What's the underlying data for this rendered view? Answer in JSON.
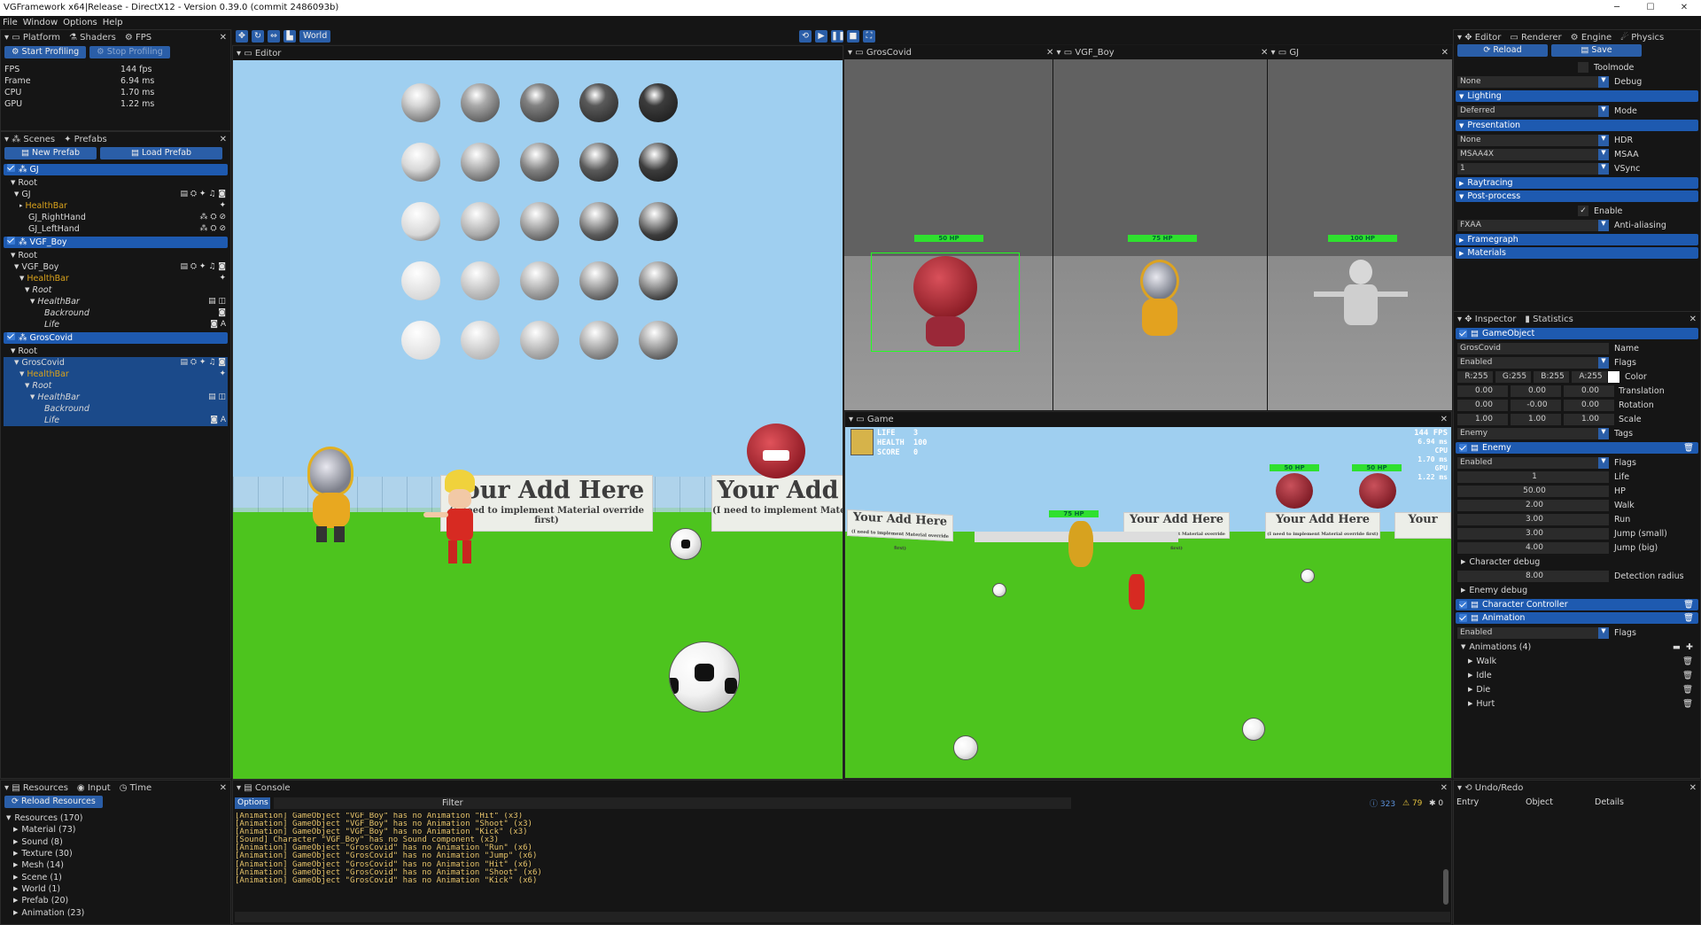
{
  "window": {
    "title": "VGFramework x64|Release - DirectX12 - Version 0.39.0 (commit 2486093b)"
  },
  "menu": [
    "File",
    "Window",
    "Options",
    "Help"
  ],
  "top_tabs": {
    "platform": "Platform",
    "shaders": "Shaders",
    "fps": "FPS"
  },
  "profiling": {
    "start": "Start Profiling",
    "stop": "Stop Profiling"
  },
  "stats": [
    {
      "k": "FPS",
      "v": "144 fps"
    },
    {
      "k": "Frame",
      "v": "6.94 ms"
    },
    {
      "k": "CPU",
      "v": "1.70 ms"
    },
    {
      "k": "GPU",
      "v": "1.22 ms"
    }
  ],
  "toolbar": {
    "world": "World"
  },
  "scenes": {
    "tab1": "Scenes",
    "tab2": "Prefabs",
    "new_prefab": "New Prefab",
    "load_prefab": "Load Prefab"
  },
  "tree": [
    {
      "t": "hdr",
      "label": "GJ",
      "x": 4
    },
    {
      "t": "row",
      "label": "Root",
      "x": 8,
      "arrow": "▼"
    },
    {
      "t": "row",
      "label": "GJ",
      "x": 12,
      "arrow": "▼",
      "icons": "▤ ⛭ ✦ ♫ ◙"
    },
    {
      "t": "row",
      "label": "HealthBar",
      "x": 18,
      "arrow": "▸",
      "cls": "orange",
      "icons": "✦"
    },
    {
      "t": "row",
      "label": "GJ_RightHand",
      "x": 28,
      "icons": "⁂ ⛭ ⊘"
    },
    {
      "t": "row",
      "label": "GJ_LeftHand",
      "x": 28,
      "icons": "⁂ ⛭ ⊘"
    },
    {
      "t": "hdr",
      "label": "VGF_Boy",
      "x": 4
    },
    {
      "t": "row",
      "label": "Root",
      "x": 8,
      "arrow": "▼"
    },
    {
      "t": "row",
      "label": "VGF_Boy",
      "x": 12,
      "arrow": "▼",
      "icons": "▤ ⛭ ✦ ♫ ◙"
    },
    {
      "t": "row",
      "label": "HealthBar",
      "x": 18,
      "arrow": "▼",
      "cls": "orange",
      "icons": "✦"
    },
    {
      "t": "row",
      "label": "Root",
      "x": 24,
      "arrow": "▼",
      "it": true
    },
    {
      "t": "row",
      "label": "HealthBar",
      "x": 30,
      "arrow": "▼",
      "it": true,
      "icons": "▤ ◫"
    },
    {
      "t": "row",
      "label": "Backround",
      "x": 46,
      "it": true,
      "icons": "◙"
    },
    {
      "t": "row",
      "label": "Life",
      "x": 46,
      "it": true,
      "icons": "◙ A"
    },
    {
      "t": "hdr",
      "label": "GrosCovid",
      "x": 4
    },
    {
      "t": "row",
      "label": "Root",
      "x": 8,
      "arrow": "▼"
    },
    {
      "t": "row",
      "label": "GrosCovid",
      "x": 12,
      "arrow": "▼",
      "sel": true,
      "icons": "▤ ⛭ ✦ ♫ ◙"
    },
    {
      "t": "row",
      "label": "HealthBar",
      "x": 18,
      "arrow": "▼",
      "cls": "orange",
      "sel": true,
      "icons": "✦"
    },
    {
      "t": "row",
      "label": "Root",
      "x": 24,
      "arrow": "▼",
      "it": true,
      "sel": true
    },
    {
      "t": "row",
      "label": "HealthBar",
      "x": 30,
      "arrow": "▼",
      "it": true,
      "sel": true,
      "icons": "▤ ◫"
    },
    {
      "t": "row",
      "label": "Backround",
      "x": 46,
      "it": true,
      "sel": true
    },
    {
      "t": "row",
      "label": "Life",
      "x": 46,
      "it": true,
      "sel": true,
      "icons": "◙ A"
    }
  ],
  "editor": {
    "tab": "Editor",
    "sign1_big": "Your Add Here",
    "sign1_small": "(I need to implement Material override first)",
    "sign2_big": "Your Add",
    "sign2_small": "(I need to implement Mate"
  },
  "views": {
    "v1": "GrosCovid",
    "v2": "VGF_Boy",
    "v3": "GJ",
    "hp1": "50 HP",
    "hp2": "75 HP",
    "hp3": "100 HP"
  },
  "game": {
    "tab": "Game",
    "life_k": "LIFE",
    "life_v": "3",
    "health_k": "HEALTH",
    "health_v": "100",
    "score_k": "SCORE",
    "score_v": "0",
    "fps": "144 FPS",
    "ms": "6.94 ms",
    "cpu": "CPU",
    "cpu_v": "1.70 ms",
    "gpu": "GPU",
    "gpu_v": "1.22 ms",
    "sign": "Your Add Here",
    "sign_short": "Your",
    "sign_small": "(I need to implement Material override first)",
    "hp_a": "50 HP",
    "hp_b": "50 HP",
    "hp_c": "75 HP"
  },
  "right": {
    "tabs": [
      "Editor",
      "Renderer",
      "Engine",
      "Physics"
    ],
    "reload": "Reload",
    "save": "Save",
    "toolmode": "Toolmode",
    "debug": {
      "value": "None",
      "label": "Debug"
    },
    "lighting": "Lighting",
    "mode": {
      "value": "Deferred",
      "label": "Mode"
    },
    "presentation": "Presentation",
    "hdr": {
      "value": "None",
      "label": "HDR"
    },
    "msaa": {
      "value": "MSAA4X",
      "label": "MSAA"
    },
    "vsync": {
      "value": "1",
      "label": "VSync"
    },
    "raytracing": "Raytracing",
    "postprocess": "Post-process",
    "enable": "Enable",
    "aa": {
      "value": "FXAA",
      "label": "Anti-aliasing"
    },
    "framegraph": "Framegraph",
    "materials": "Materials"
  },
  "inspector": {
    "tab1": "Inspector",
    "tab2": "Statistics",
    "gameobject": "GameObject",
    "name": {
      "value": "GrosCovid",
      "label": "Name"
    },
    "flags": {
      "value": "Enabled",
      "label": "Flags"
    },
    "color": {
      "r": "R:255",
      "g": "G:255",
      "b": "B:255",
      "a": "A:255",
      "label": "Color"
    },
    "translation": {
      "x": "0.00",
      "y": "0.00",
      "z": "0.00",
      "label": "Translation"
    },
    "rotation": {
      "x": "0.00",
      "y": "-0.00",
      "z": "0.00",
      "label": "Rotation"
    },
    "scale": {
      "x": "1.00",
      "y": "1.00",
      "z": "1.00",
      "label": "Scale"
    },
    "tags": {
      "value": "Enemy",
      "label": "Tags"
    },
    "enemy": "Enemy",
    "enemy_flags": {
      "value": "Enabled",
      "label": "Flags"
    },
    "life": {
      "value": "1",
      "label": "Life"
    },
    "hp": {
      "value": "50.00",
      "label": "HP"
    },
    "walk": {
      "value": "2.00",
      "label": "Walk"
    },
    "run": {
      "value": "3.00",
      "label": "Run"
    },
    "jump_small": {
      "value": "3.00",
      "label": "Jump (small)"
    },
    "jump_big": {
      "value": "4.00",
      "label": "Jump (big)"
    },
    "char_debug": "Character debug",
    "detection": {
      "value": "8.00",
      "label": "Detection radius"
    },
    "enemy_debug": "Enemy debug",
    "char_controller": "Character Controller",
    "animation": "Animation",
    "anim_flags": {
      "value": "Enabled",
      "label": "Flags"
    },
    "animations": "Animations (4)",
    "anim_list": [
      "Walk",
      "Idle",
      "Die",
      "Hurt"
    ]
  },
  "bottom": {
    "tabs": [
      "Resources",
      "Input",
      "Time"
    ],
    "reload_resources": "Reload Resources",
    "resources": [
      "Resources (170)",
      "Material (73)",
      "Sound (8)",
      "Texture (30)",
      "Mesh (14)",
      "Scene (1)",
      "World (1)",
      "Prefab (20)",
      "Animation (23)"
    ],
    "console_tab": "Console",
    "options": "Options",
    "filter": "Filter",
    "counts": {
      "info": "323",
      "warn": "79",
      "err": "0"
    },
    "lines": [
      "[Animation] GameObject \"VGF_Boy\" has no Animation \"Hit\" (x3)",
      "[Animation] GameObject \"VGF_Boy\" has no Animation \"Shoot\" (x3)",
      "[Animation] GameObject \"VGF_Boy\" has no Animation \"Kick\" (x3)",
      "[Sound] Character \"VGF_Boy\" has no Sound component (x3)",
      "[Animation] GameObject \"GrosCovid\" has no Animation \"Run\" (x6)",
      "[Animation] GameObject \"GrosCovid\" has no Animation \"Jump\" (x6)",
      "[Animation] GameObject \"GrosCovid\" has no Animation \"Hit\" (x6)",
      "[Animation] GameObject \"GrosCovid\" has no Animation \"Shoot\" (x6)",
      "[Animation] GameObject \"GrosCovid\" has no Animation \"Kick\" (x6)"
    ],
    "undo_tab": "Undo/Redo",
    "undo_cols": [
      "Entry",
      "Object",
      "Details"
    ]
  }
}
